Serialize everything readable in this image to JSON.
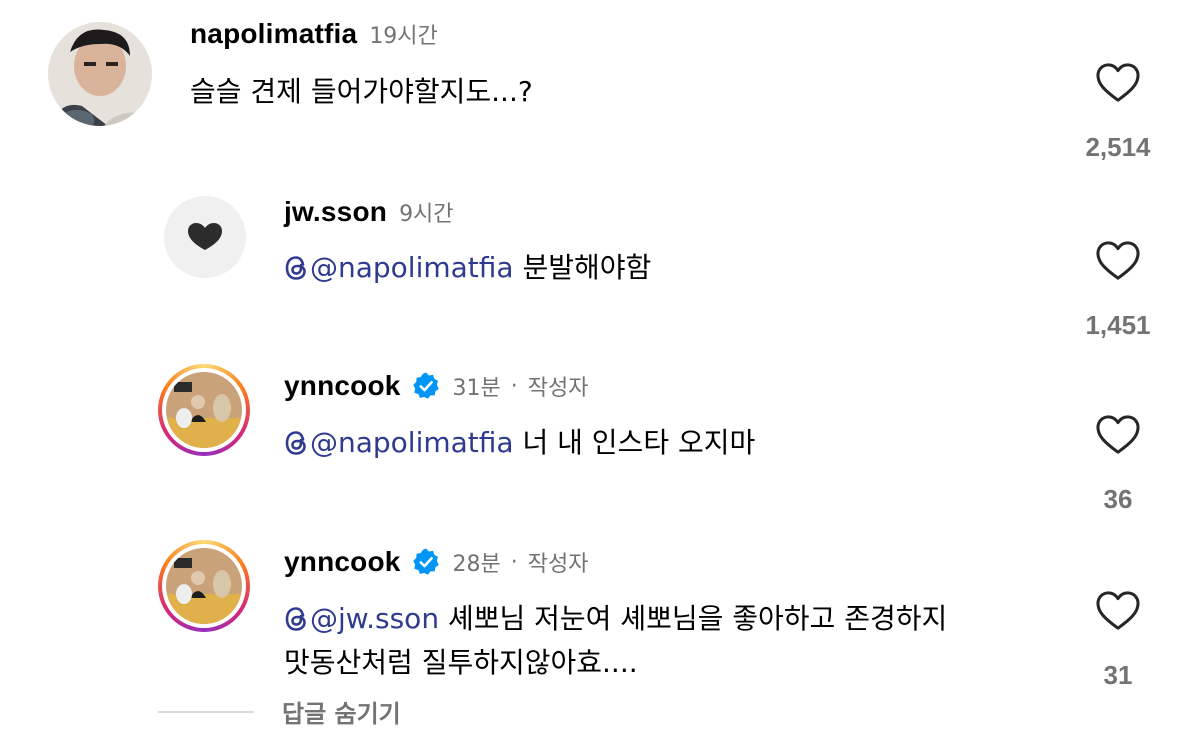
{
  "comments": [
    {
      "username": "napolimatfia",
      "time": "19시간",
      "verified": false,
      "author_tag": "",
      "mention": "",
      "text_lines": [
        "슬슬 견제 들어가야할지도...?"
      ],
      "likes": "2,514"
    },
    {
      "username": "jw.sson",
      "time": "9시간",
      "verified": false,
      "author_tag": "",
      "mention": "@napolimatfia",
      "text_lines": [
        " 분발해야함"
      ],
      "likes": "1,451"
    },
    {
      "username": "ynncook",
      "time": "31분",
      "verified": true,
      "author_tag": "작성자",
      "mention": "@napolimatfia",
      "text_lines": [
        " 너 내 인스타 오지마"
      ],
      "likes": "36"
    },
    {
      "username": "ynncook",
      "time": "28분",
      "verified": true,
      "author_tag": "작성자",
      "mention": "@jw.sson",
      "text_lines": [
        " 셰뽀님 저눈여 셰뽀님을 좋아하고 존경하지",
        "맛동산처럼 질투하지않아효...."
      ],
      "likes": "31"
    }
  ],
  "separator": "·",
  "hide_replies_label": "답글 숨기기",
  "colors": {
    "mention": "#2f3b8f",
    "secondary_text": "#737373",
    "verified": "#0095f6"
  },
  "icons": [
    "heart-icon",
    "verified-badge-icon",
    "threads-icon"
  ]
}
